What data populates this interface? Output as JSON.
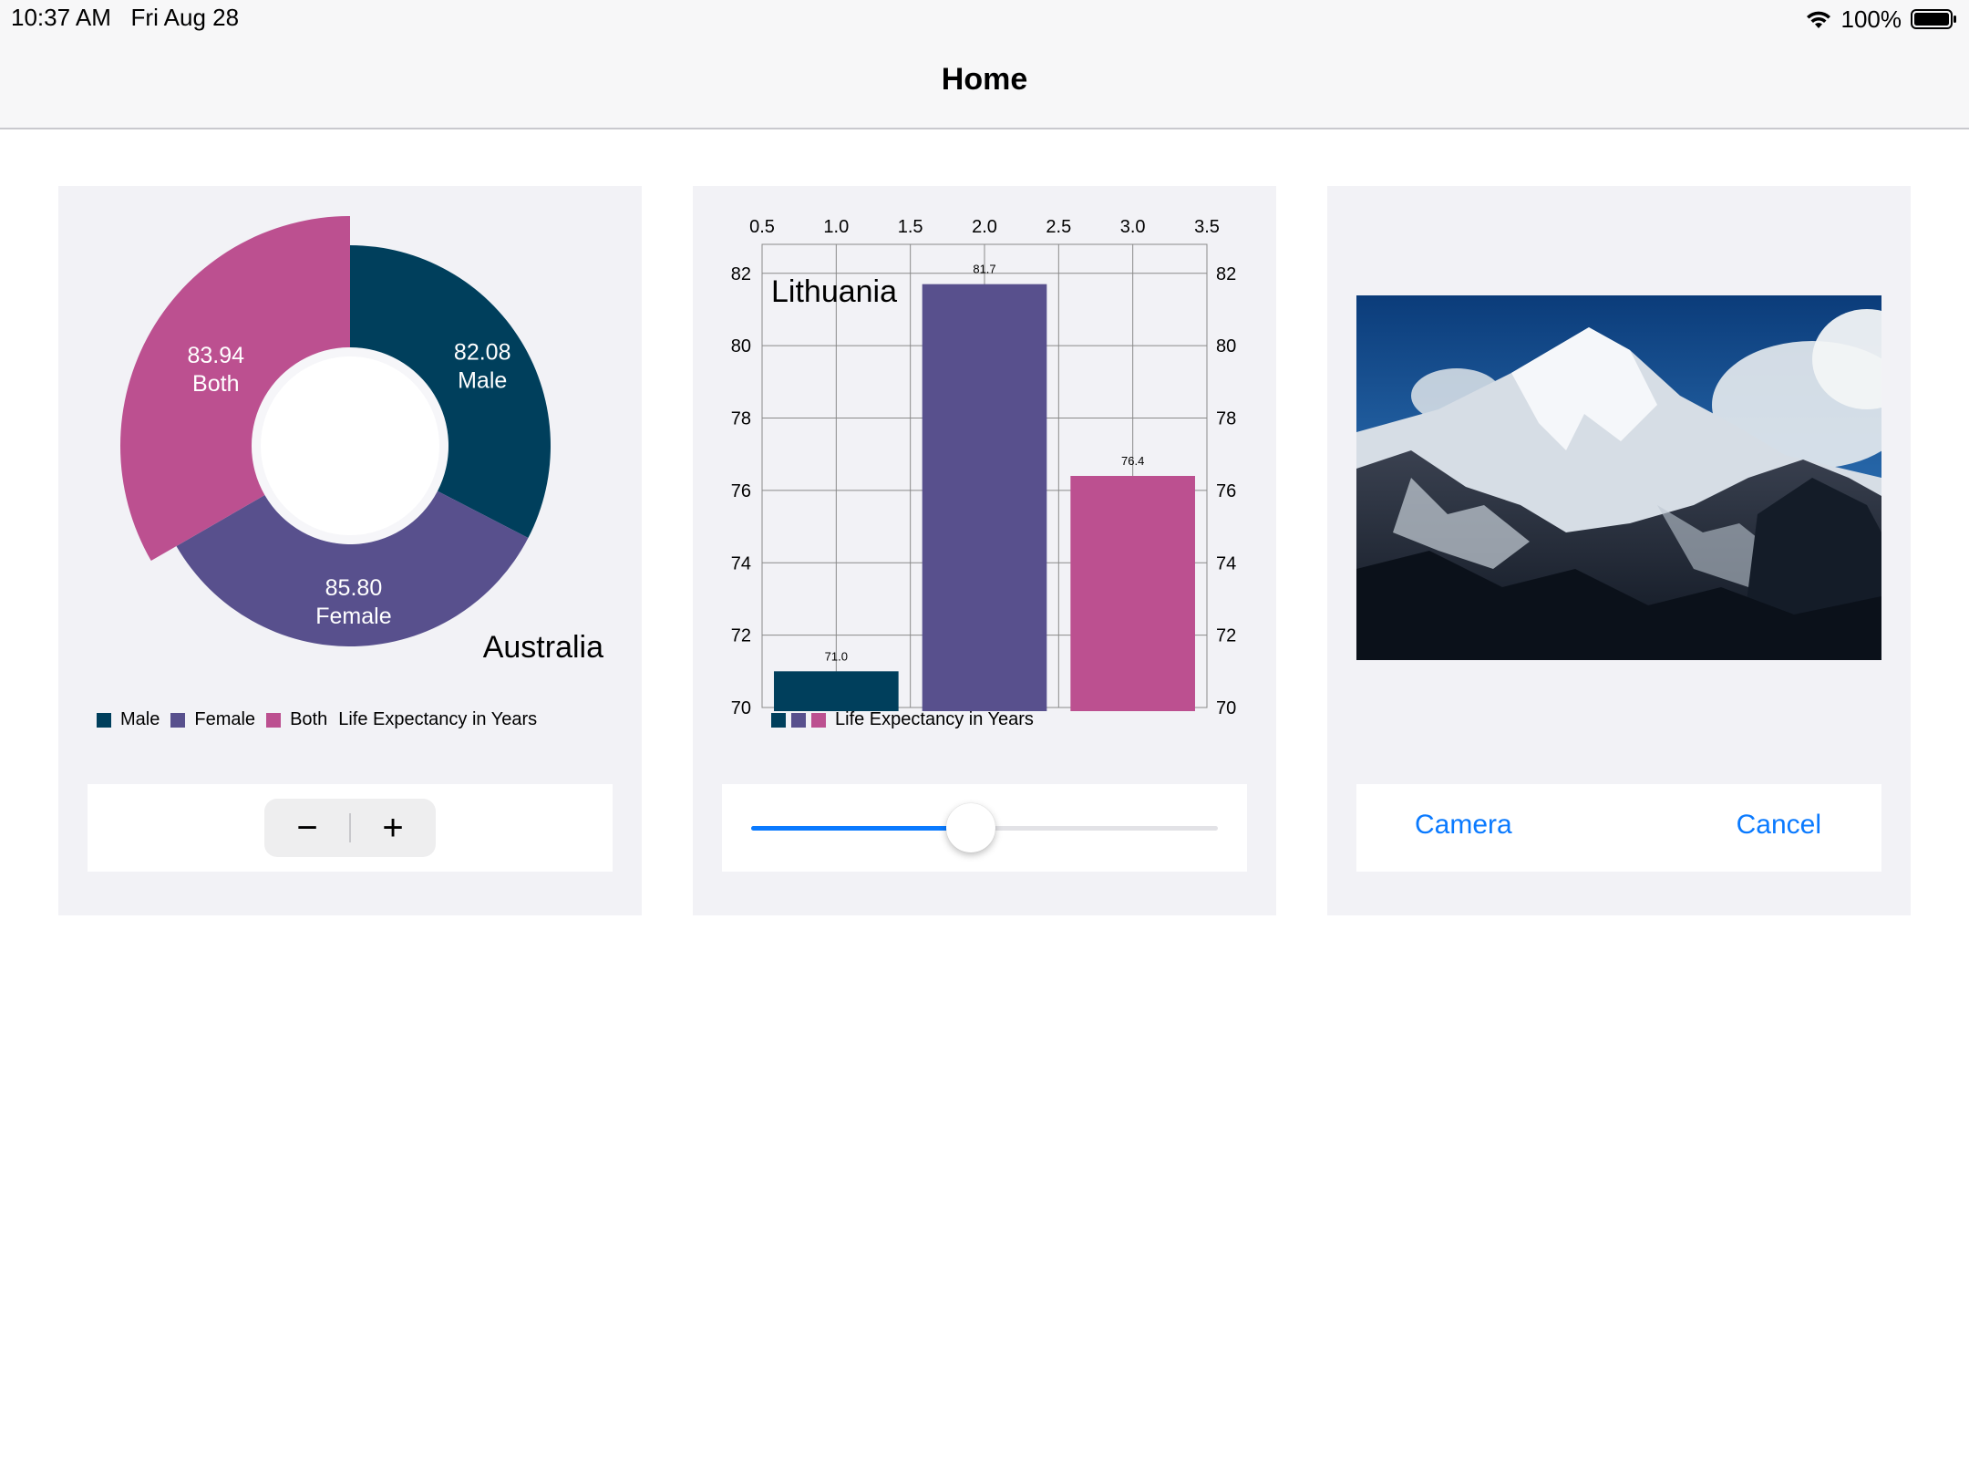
{
  "status_bar": {
    "time": "10:37 AM",
    "date": "Fri Aug 28",
    "battery_percent": "100%",
    "battery_level": 1.0,
    "wifi_icon": "wifi-icon",
    "battery_icon": "battery-icon"
  },
  "nav": {
    "title": "Home"
  },
  "colors": {
    "male": "#003f5c",
    "female": "#58508d",
    "both": "#bc5090",
    "accent": "#0a7aff",
    "card_bg": "#f2f2f6"
  },
  "chart_data": [
    {
      "type": "pie",
      "variant": "donut",
      "title": "Australia",
      "series_label": "Life Expectancy in Years",
      "slices": [
        {
          "name": "Male",
          "value": 82.08,
          "value_label": "82.08"
        },
        {
          "name": "Female",
          "value": 85.8,
          "value_label": "85.80"
        },
        {
          "name": "Both",
          "value": 83.94,
          "value_label": "83.94"
        }
      ],
      "legend": [
        "Male",
        "Female",
        "Both",
        "Life Expectancy in Years"
      ],
      "legend_position": "bottom",
      "exploded_slice": "Both"
    },
    {
      "type": "bar",
      "title": "Lithuania",
      "x": [
        1.0,
        2.0,
        3.0
      ],
      "values": [
        71.0,
        81.7,
        76.4
      ],
      "value_labels": [
        "71.0",
        "81.7",
        "76.4"
      ],
      "series_colors": [
        "#003f5c",
        "#58508d",
        "#bc5090"
      ],
      "xlim": [
        0.5,
        3.5
      ],
      "x_ticks": [
        "0.5",
        "1.0",
        "1.5",
        "2.0",
        "2.5",
        "3.0",
        "3.5"
      ],
      "x_axis_position": "top",
      "ylim": [
        70,
        82.8
      ],
      "y_ticks": [
        "70",
        "72",
        "74",
        "76",
        "78",
        "80",
        "82"
      ],
      "y_axis": "both sides",
      "grid": true,
      "legend": [
        "Life Expectancy in Years"
      ],
      "legend_position": "bottom-left"
    }
  ],
  "stepper": {
    "minus": "−",
    "plus": "+"
  },
  "slider": {
    "value": 0.47
  },
  "photo": {
    "alt": "mountain-photo"
  },
  "camera_panel": {
    "camera_label": "Camera",
    "cancel_label": "Cancel"
  }
}
